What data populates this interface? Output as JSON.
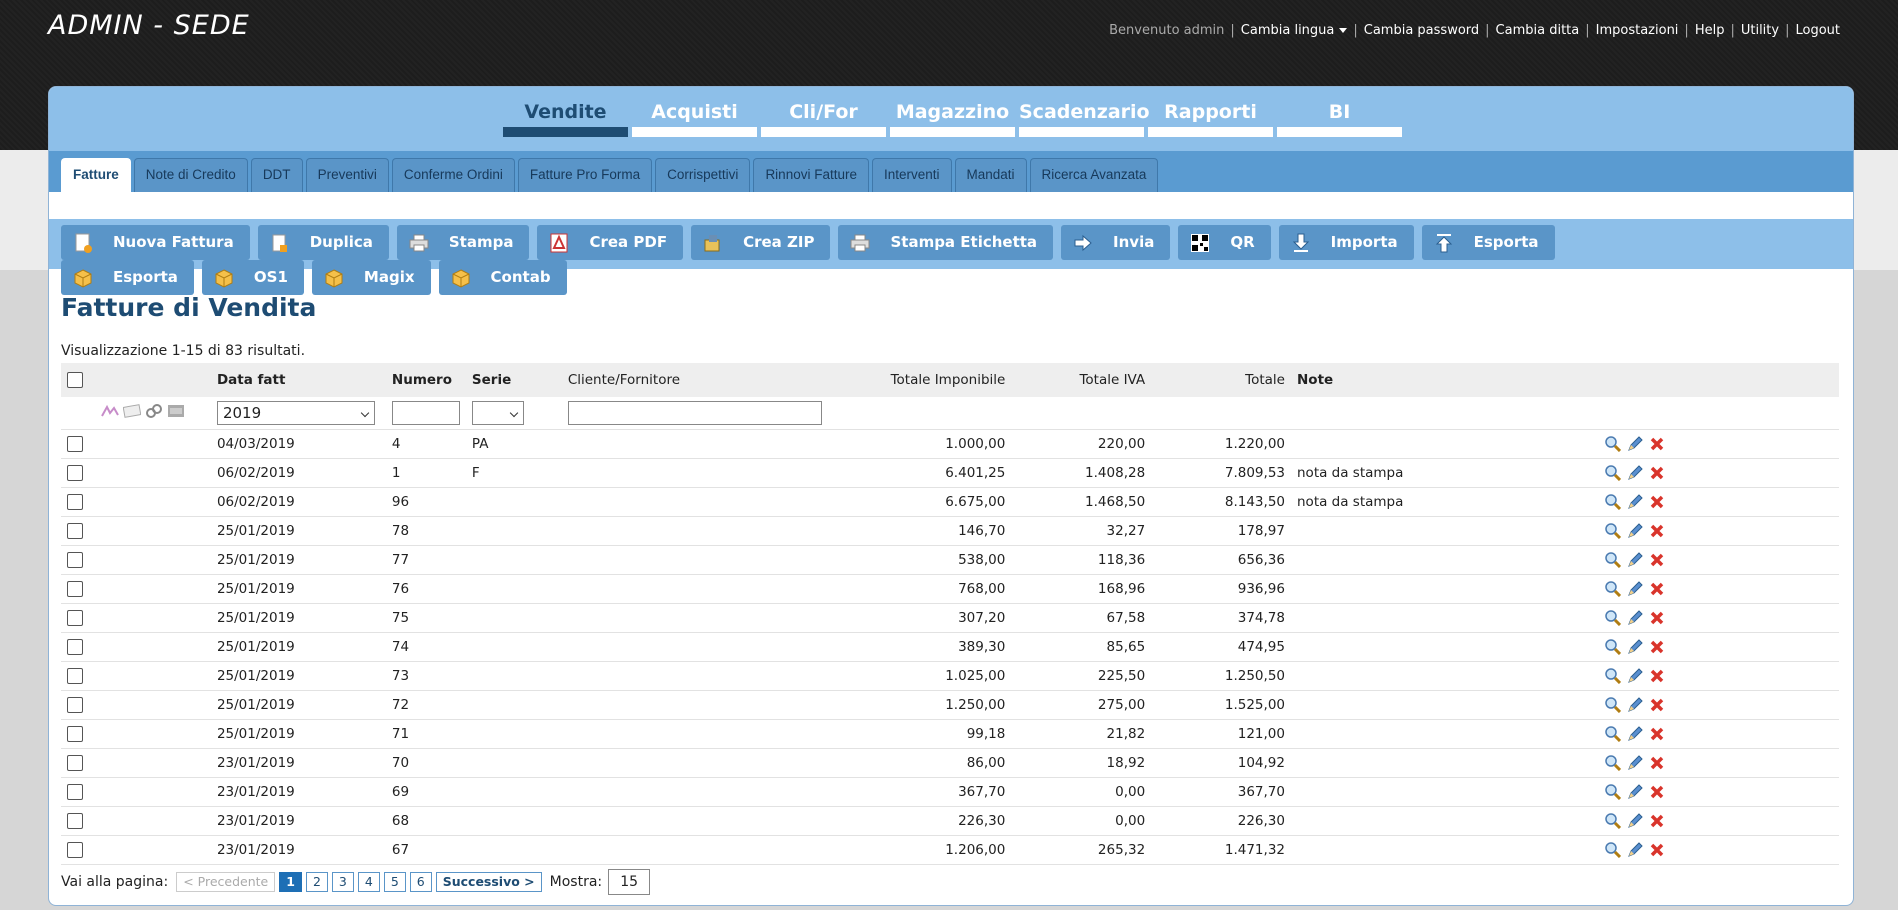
{
  "app": {
    "title": "ADMIN - SEDE"
  },
  "toplinks": {
    "welcome": "Benvenuto admin",
    "language": "Cambia lingua",
    "password": "Cambia password",
    "company": "Cambia ditta",
    "settings": "Impostazioni",
    "help": "Help",
    "utility": "Utility",
    "logout": "Logout"
  },
  "main_nav": [
    {
      "label": "Vendite",
      "active": true
    },
    {
      "label": "Acquisti"
    },
    {
      "label": "Cli/For"
    },
    {
      "label": "Magazzino"
    },
    {
      "label": "Scadenzario"
    },
    {
      "label": "Rapporti"
    },
    {
      "label": "BI"
    }
  ],
  "sub_nav": [
    {
      "label": "Fatture",
      "active": true
    },
    {
      "label": "Note di Credito"
    },
    {
      "label": "DDT"
    },
    {
      "label": "Preventivi"
    },
    {
      "label": "Conferme Ordini"
    },
    {
      "label": "Fatture Pro Forma"
    },
    {
      "label": "Corrispettivi"
    },
    {
      "label": "Rinnovi Fatture"
    },
    {
      "label": "Interventi"
    },
    {
      "label": "Mandati"
    },
    {
      "label": "Ricerca Avanzata"
    }
  ],
  "toolbar": [
    {
      "label": "Nuova Fattura",
      "icon": "new-document-icon"
    },
    {
      "label": "Duplica",
      "icon": "duplicate-icon"
    },
    {
      "label": "Stampa",
      "icon": "printer-icon"
    },
    {
      "label": "Crea PDF",
      "icon": "pdf-icon"
    },
    {
      "label": "Crea ZIP",
      "icon": "zip-icon"
    },
    {
      "label": "Stampa Etichetta",
      "icon": "printer-icon"
    },
    {
      "label": "Invia",
      "icon": "send-arrow-icon"
    },
    {
      "label": "QR",
      "icon": "qr-code-icon"
    },
    {
      "label": "Importa",
      "icon": "import-icon"
    },
    {
      "label": "Esporta",
      "icon": "export-icon"
    },
    {
      "label": "Esporta",
      "icon": "box-icon"
    },
    {
      "label": "OS1",
      "icon": "box-icon"
    },
    {
      "label": "Magix",
      "icon": "box-icon"
    },
    {
      "label": "Contab",
      "icon": "box-icon"
    }
  ],
  "page": {
    "title": "Fatture di Vendita",
    "results": "Visualizzazione 1-15 di 83 risultati."
  },
  "table": {
    "headers": {
      "date": "Data fatt",
      "number": "Numero",
      "series": "Serie",
      "client": "Cliente/Fornitore",
      "taxable": "Totale Imponibile",
      "vat": "Totale IVA",
      "total": "Totale",
      "notes": "Note"
    },
    "filter": {
      "year": "2019"
    },
    "rows": [
      {
        "date": "04/03/2019",
        "number": "4",
        "series": "PA",
        "client": "",
        "taxable": "1.000,00",
        "vat": "220,00",
        "total": "1.220,00",
        "notes": ""
      },
      {
        "date": "06/02/2019",
        "number": "1",
        "series": "F",
        "client": "",
        "taxable": "6.401,25",
        "vat": "1.408,28",
        "total": "7.809,53",
        "notes": "nota da stampa"
      },
      {
        "date": "06/02/2019",
        "number": "96",
        "series": "",
        "client": "",
        "taxable": "6.675,00",
        "vat": "1.468,50",
        "total": "8.143,50",
        "notes": "nota da stampa"
      },
      {
        "date": "25/01/2019",
        "number": "78",
        "series": "",
        "client": "",
        "taxable": "146,70",
        "vat": "32,27",
        "total": "178,97",
        "notes": ""
      },
      {
        "date": "25/01/2019",
        "number": "77",
        "series": "",
        "client": "",
        "taxable": "538,00",
        "vat": "118,36",
        "total": "656,36",
        "notes": ""
      },
      {
        "date": "25/01/2019",
        "number": "76",
        "series": "",
        "client": "",
        "taxable": "768,00",
        "vat": "168,96",
        "total": "936,96",
        "notes": ""
      },
      {
        "date": "25/01/2019",
        "number": "75",
        "series": "",
        "client": "",
        "taxable": "307,20",
        "vat": "67,58",
        "total": "374,78",
        "notes": ""
      },
      {
        "date": "25/01/2019",
        "number": "74",
        "series": "",
        "client": "",
        "taxable": "389,30",
        "vat": "85,65",
        "total": "474,95",
        "notes": ""
      },
      {
        "date": "25/01/2019",
        "number": "73",
        "series": "",
        "client": "",
        "taxable": "1.025,00",
        "vat": "225,50",
        "total": "1.250,50",
        "notes": ""
      },
      {
        "date": "25/01/2019",
        "number": "72",
        "series": "",
        "client": "",
        "taxable": "1.250,00",
        "vat": "275,00",
        "total": "1.525,00",
        "notes": ""
      },
      {
        "date": "25/01/2019",
        "number": "71",
        "series": "",
        "client": "",
        "taxable": "99,18",
        "vat": "21,82",
        "total": "121,00",
        "notes": ""
      },
      {
        "date": "23/01/2019",
        "number": "70",
        "series": "",
        "client": "",
        "taxable": "86,00",
        "vat": "18,92",
        "total": "104,92",
        "notes": ""
      },
      {
        "date": "23/01/2019",
        "number": "69",
        "series": "",
        "client": "",
        "taxable": "367,70",
        "vat": "0,00",
        "total": "367,70",
        "notes": ""
      },
      {
        "date": "23/01/2019",
        "number": "68",
        "series": "",
        "client": "",
        "taxable": "226,30",
        "vat": "0,00",
        "total": "226,30",
        "notes": ""
      },
      {
        "date": "23/01/2019",
        "number": "67",
        "series": "",
        "client": "",
        "taxable": "1.206,00",
        "vat": "265,32",
        "total": "1.471,32",
        "notes": ""
      }
    ]
  },
  "pager": {
    "label": "Vai alla pagina:",
    "prev": "< Precedente",
    "pages": [
      "1",
      "2",
      "3",
      "4",
      "5",
      "6"
    ],
    "current": "1",
    "next": "Successivo >",
    "show_label": "Mostra:",
    "show_value": "15"
  },
  "colors": {
    "nav_bg": "#8dbfe9",
    "tab_bg": "#5a95c8",
    "title": "#1e4c73",
    "delete": "#d9342b"
  }
}
